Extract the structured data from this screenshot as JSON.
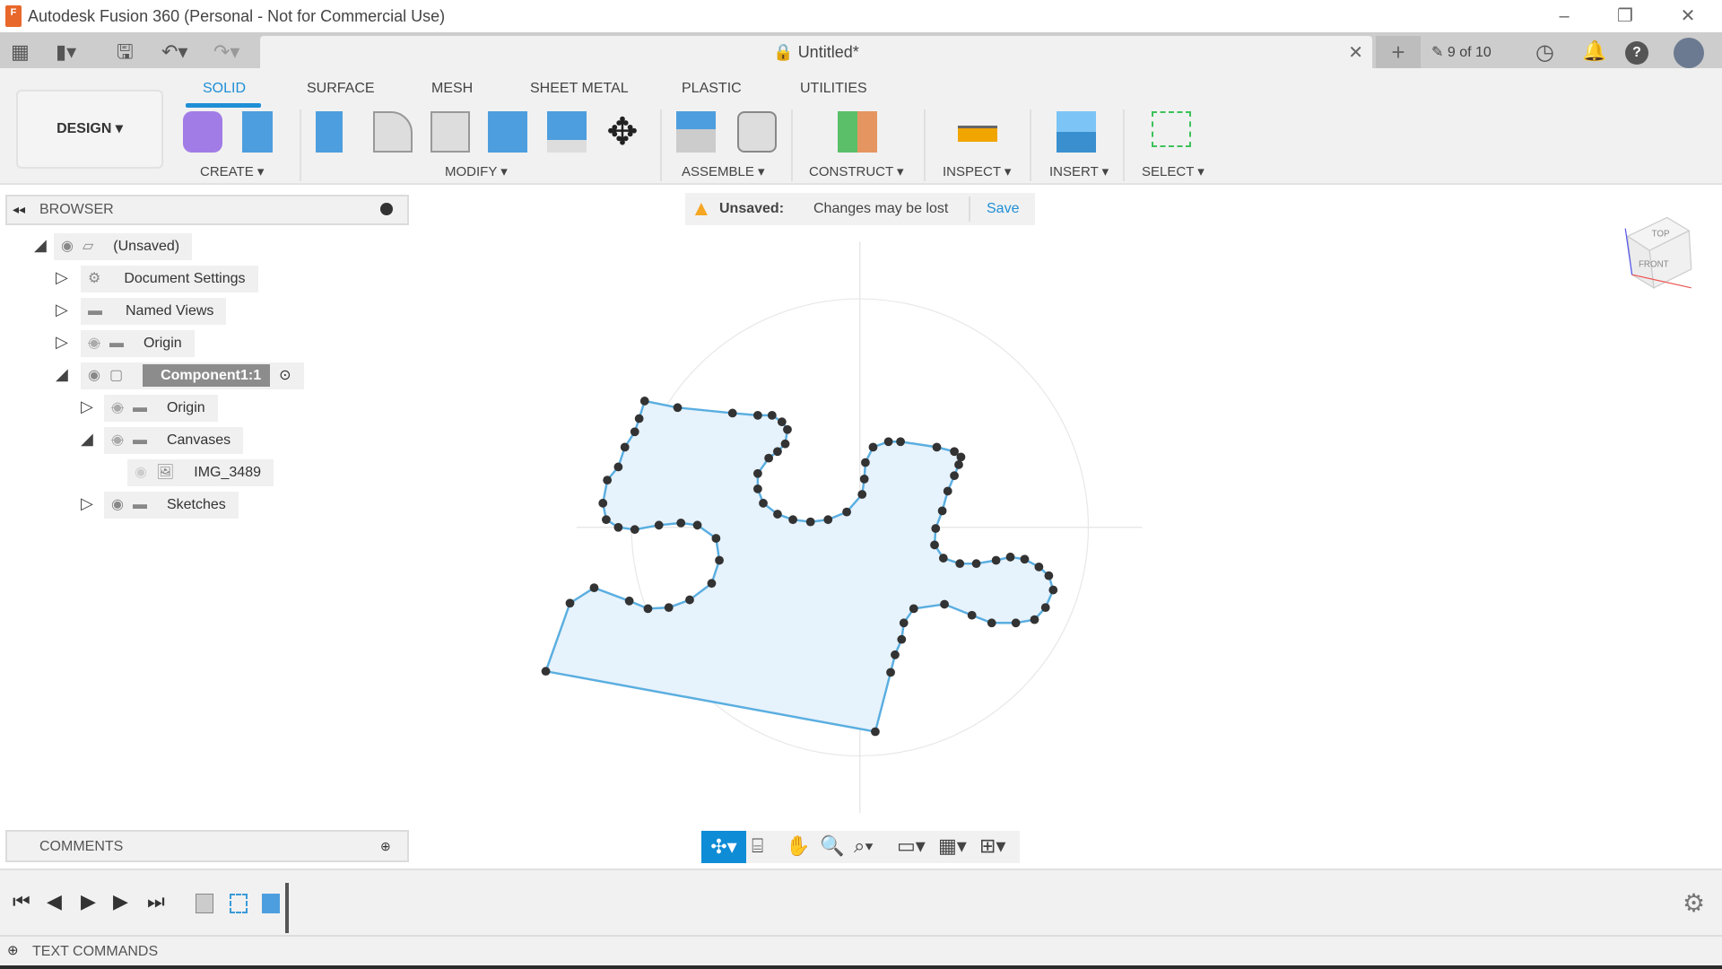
{
  "window": {
    "title": "Autodesk Fusion 360 (Personal - Not for Commercial Use)",
    "logo_letter": "F"
  },
  "document": {
    "title": "Untitled*",
    "job_status": "9 of 10"
  },
  "workspace": {
    "label": "DESIGN ▾"
  },
  "tabs": [
    {
      "label": "SOLID",
      "active": true
    },
    {
      "label": "SURFACE"
    },
    {
      "label": "MESH"
    },
    {
      "label": "SHEET METAL"
    },
    {
      "label": "PLASTIC"
    },
    {
      "label": "UTILITIES"
    }
  ],
  "groups": {
    "create": "CREATE ▾",
    "modify": "MODIFY ▾",
    "assemble": "ASSEMBLE ▾",
    "construct": "CONSTRUCT ▾",
    "inspect": "INSPECT ▾",
    "insert": "INSERT ▾",
    "select": "SELECT ▾"
  },
  "browser": {
    "title": "BROWSER",
    "items": [
      {
        "label": "(Unsaved)"
      },
      {
        "label": "Document Settings"
      },
      {
        "label": "Named Views"
      },
      {
        "label": "Origin"
      },
      {
        "label": "Component1:1"
      },
      {
        "label": "Origin"
      },
      {
        "label": "Canvases"
      },
      {
        "label": "IMG_3489"
      },
      {
        "label": "Sketches"
      }
    ]
  },
  "notice": {
    "title": "Unsaved:",
    "message": "Changes may be lost",
    "action": "Save"
  },
  "viewcube": {
    "top": "TOP",
    "front": "FRONT"
  },
  "comments": {
    "title": "COMMENTS"
  },
  "text_commands": {
    "title": "TEXT COMMANDS"
  },
  "colors": {
    "accent": "#1f8fd6",
    "sketch_fill": "#e6f2fc",
    "sketch_line": "#5aaee0",
    "warning": "#f5a623"
  }
}
